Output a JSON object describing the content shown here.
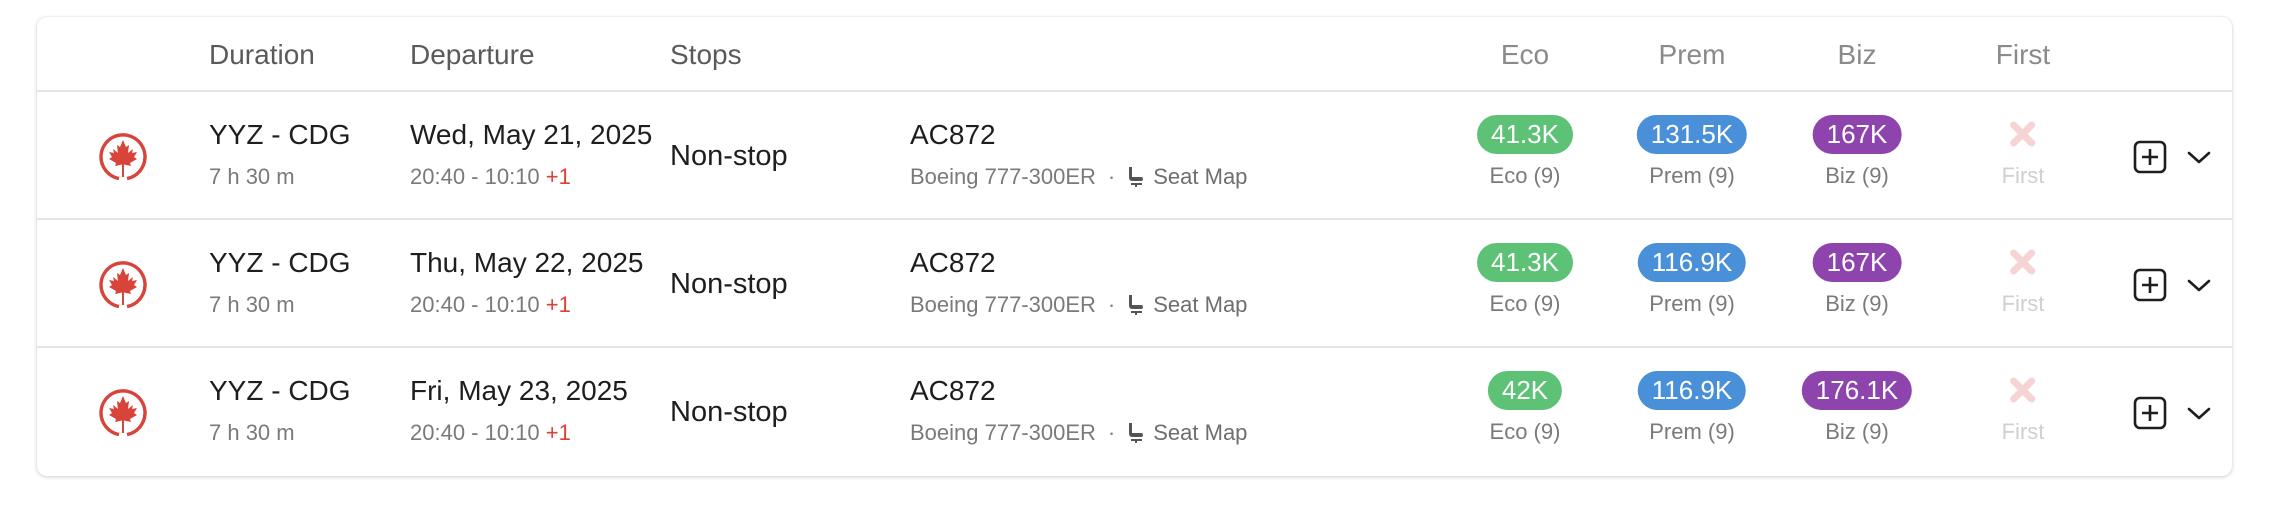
{
  "header": {
    "duration": "Duration",
    "departure": "Departure",
    "stops": "Stops",
    "eco": "Eco",
    "prem": "Prem",
    "biz": "Biz",
    "first": "First"
  },
  "colors": {
    "eco": "#5dc275",
    "prem": "#4a90d9",
    "biz": "#8e44ad",
    "airline_red": "#d8433a",
    "unavailable": "#f6d4d4"
  },
  "icons": {
    "airline_logo": "air-canada-maple-leaf-icon",
    "seat": "seat-icon",
    "unavailable": "x-icon",
    "add": "plus-square-icon",
    "expand": "chevron-down-icon"
  },
  "rows": [
    {
      "route": "YYZ - CDG",
      "duration": "7 h 30 m",
      "date": "Wed, May 21, 2025",
      "times": "20:40 - 10:10",
      "day_offset": "+1",
      "stops": "Non-stop",
      "flight": "AC872",
      "aircraft": "Boeing 777-300ER",
      "separator": "·",
      "seat_map": "Seat Map",
      "eco": {
        "price": "41.3K",
        "label": "Eco (9)"
      },
      "prem": {
        "price": "131.5K",
        "label": "Prem (9)"
      },
      "biz": {
        "price": "167K",
        "label": "Biz (9)"
      },
      "first": {
        "label": "First",
        "available": false
      }
    },
    {
      "route": "YYZ - CDG",
      "duration": "7 h 30 m",
      "date": "Thu, May 22, 2025",
      "times": "20:40 - 10:10",
      "day_offset": "+1",
      "stops": "Non-stop",
      "flight": "AC872",
      "aircraft": "Boeing 777-300ER",
      "separator": "·",
      "seat_map": "Seat Map",
      "eco": {
        "price": "41.3K",
        "label": "Eco (9)"
      },
      "prem": {
        "price": "116.9K",
        "label": "Prem (9)"
      },
      "biz": {
        "price": "167K",
        "label": "Biz (9)"
      },
      "first": {
        "label": "First",
        "available": false
      }
    },
    {
      "route": "YYZ - CDG",
      "duration": "7 h 30 m",
      "date": "Fri, May 23, 2025",
      "times": "20:40 - 10:10",
      "day_offset": "+1",
      "stops": "Non-stop",
      "flight": "AC872",
      "aircraft": "Boeing 777-300ER",
      "separator": "·",
      "seat_map": "Seat Map",
      "eco": {
        "price": "42K",
        "label": "Eco (9)"
      },
      "prem": {
        "price": "116.9K",
        "label": "Prem (9)"
      },
      "biz": {
        "price": "176.1K",
        "label": "Biz (9)"
      },
      "first": {
        "label": "First",
        "available": false
      }
    }
  ]
}
